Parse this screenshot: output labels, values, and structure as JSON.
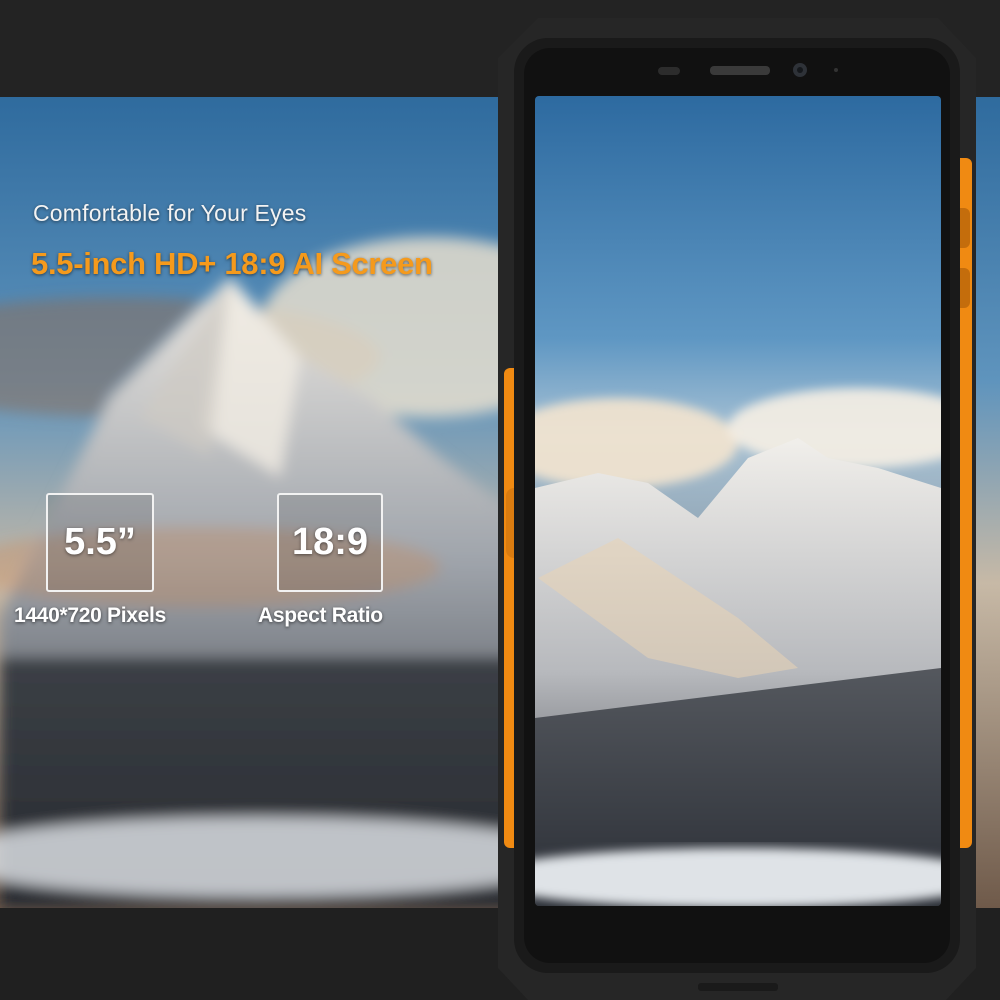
{
  "banner": {
    "headline": "Comfortable for Your Eyes",
    "subheadline": "5.5-inch HD+ 18:9 AI Screen"
  },
  "specs": [
    {
      "value": "5.5”",
      "caption": "1440*720 Pixels"
    },
    {
      "value": "18:9",
      "caption": "Aspect Ratio"
    }
  ],
  "colors": {
    "accent": "#f59a1c",
    "phone_body": "#2a2a2a",
    "phone_orange": "#f08a12",
    "sky_top": "#2f6b9e",
    "snow": "#e8e6e2"
  }
}
